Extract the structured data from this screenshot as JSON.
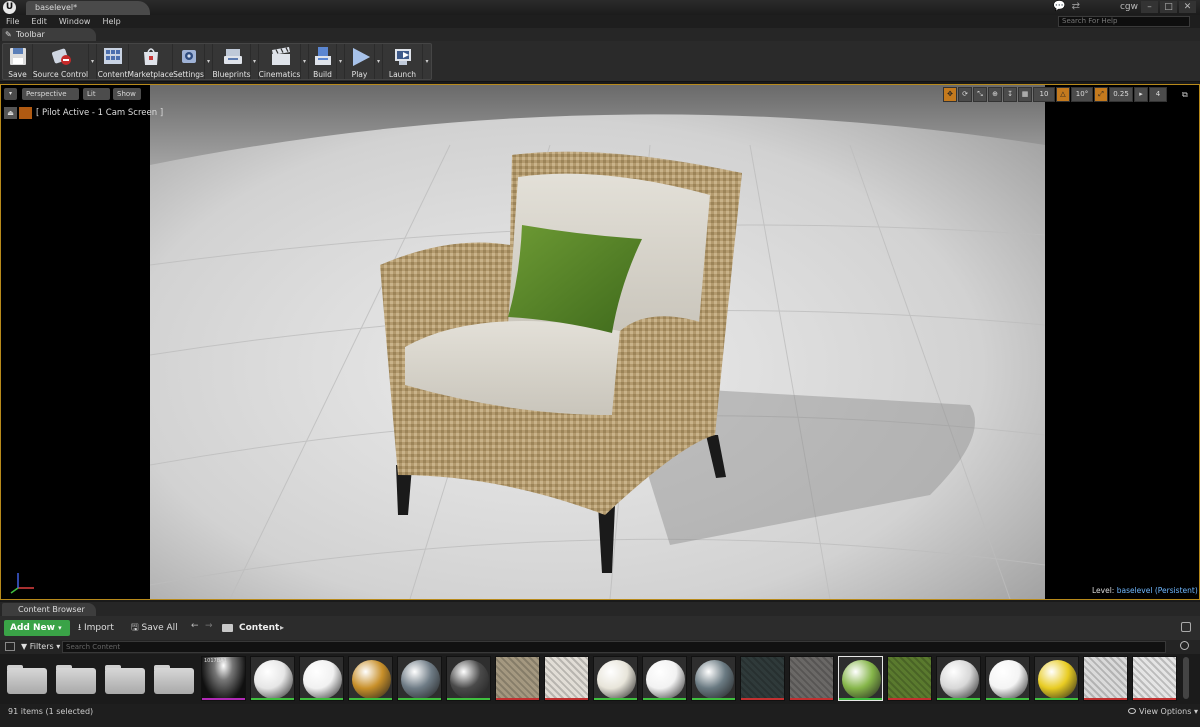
{
  "title_bar": {
    "logo": "U",
    "document_tab": "baselevel*",
    "user_name": "cgw",
    "window_buttons": [
      "–",
      "□",
      "✕"
    ]
  },
  "menu": {
    "items": [
      "File",
      "Edit",
      "Window",
      "Help"
    ],
    "help_search_placeholder": "Search For Help"
  },
  "toolbar": {
    "tab_label": "Toolbar",
    "buttons": [
      {
        "label": "Save",
        "icon": "save-icon",
        "dropdown": false
      },
      {
        "label": "Source Control",
        "icon": "source-control-icon",
        "dropdown": true
      },
      {
        "label": "Content",
        "icon": "content-icon",
        "dropdown": false
      },
      {
        "label": "Marketplace",
        "icon": "marketplace-icon",
        "dropdown": false
      },
      {
        "label": "Settings",
        "icon": "settings-icon",
        "dropdown": true
      },
      {
        "label": "Blueprints",
        "icon": "blueprints-icon",
        "dropdown": true
      },
      {
        "label": "Cinematics",
        "icon": "cinematics-icon",
        "dropdown": true
      },
      {
        "label": "Build",
        "icon": "build-icon",
        "dropdown": true
      },
      {
        "label": "Play",
        "icon": "play-icon",
        "dropdown": true
      },
      {
        "label": "Launch",
        "icon": "launch-icon",
        "dropdown": true
      }
    ]
  },
  "viewport": {
    "options_glyph": "▾",
    "perspective_label": "Perspective",
    "lit_label": "Lit",
    "show_label": "Show",
    "pilot_text": "[ Pilot Active - 1 Cam Screen ]",
    "grid_snap": "10",
    "rotation_snap": "10°",
    "scale_snap": "0.25",
    "camera_speed": "4",
    "level_prefix": "Level:",
    "level_name": "baselevel (Persistent)",
    "border_color": "#b88a1b"
  },
  "content_browser": {
    "tab_label": "Content Browser",
    "add_new_label": "Add New",
    "import_label": "Import",
    "save_all_label": "Save All",
    "path_root": "Content",
    "filters_label": "Filters",
    "search_placeholder": "Search Content",
    "item_count": "91 items (1 selected)",
    "view_options_label": "View Options",
    "assets": [
      {
        "kind": "folder"
      },
      {
        "kind": "folder"
      },
      {
        "kind": "folder"
      },
      {
        "kind": "folder"
      },
      {
        "kind": "texture",
        "label": "1017BA1",
        "bar": "#b02ab5"
      },
      {
        "kind": "material",
        "color": "#e6e6e6",
        "bar": "#3fbf3f"
      },
      {
        "kind": "material",
        "color": "#f1f1f1",
        "bar": "#3fbf3f"
      },
      {
        "kind": "material",
        "color": "#c8902a",
        "bar": "#3fbf3f"
      },
      {
        "kind": "material",
        "color": "#6f7c86",
        "bar": "#3fbf3f"
      },
      {
        "kind": "material",
        "color": "#4a4a4a",
        "bar": "#3fbf3f"
      },
      {
        "kind": "texture",
        "color": "#a49880",
        "bar": "#c23030"
      },
      {
        "kind": "texture",
        "color": "#e1ddd6",
        "bar": "#c23030"
      },
      {
        "kind": "material",
        "color": "#e8e5da",
        "bar": "#3fbf3f"
      },
      {
        "kind": "material",
        "color": "#f2f2f2",
        "bar": "#3fbf3f"
      },
      {
        "kind": "material",
        "color": "#6a7a82",
        "bar": "#3fbf3f"
      },
      {
        "kind": "texture",
        "color": "#2f3a3a",
        "bar": "#c23030"
      },
      {
        "kind": "texture",
        "color": "#6a6866",
        "bar": "#c23030"
      },
      {
        "kind": "material",
        "color": "#86b64a",
        "bar": "#3fbf3f",
        "selected": true
      },
      {
        "kind": "texture",
        "color": "#5a7a2e",
        "bar": "#c23030"
      },
      {
        "kind": "material",
        "color": "#d8d8d8",
        "bar": "#3fbf3f"
      },
      {
        "kind": "material",
        "color": "#f4f4f4",
        "bar": "#3fbf3f"
      },
      {
        "kind": "material",
        "color": "#e8cc22",
        "bar": "#3fbf3f"
      },
      {
        "kind": "texture",
        "color": "#dadada",
        "bar": "#c23030"
      },
      {
        "kind": "texture",
        "color": "#e4e4e4",
        "bar": "#c23030"
      }
    ]
  },
  "colors": {
    "accent_green": "#3aa347",
    "viewport_border": "#b88a1b",
    "level_name": "#6fb8ff"
  }
}
